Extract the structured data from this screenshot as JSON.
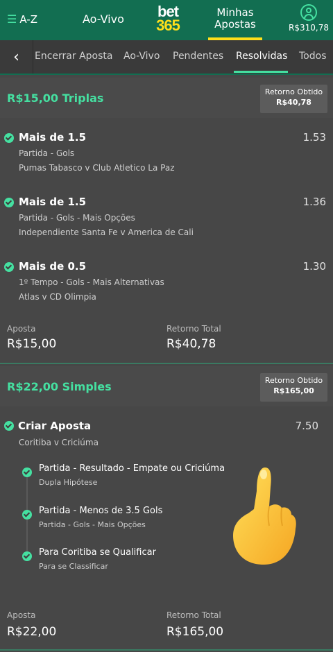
{
  "topbar": {
    "az_label": "A-Z",
    "aovivo_label": "Ao-Vivo",
    "logo_top": "bet",
    "logo_bottom": "365",
    "minhas_apostas": "Minhas Apostas",
    "balance": "R$310,78",
    "colors": {
      "brand_green": "#126e51",
      "accent_green": "#45e0a1",
      "brand_yellow": "#ffdf1b"
    }
  },
  "tabs": {
    "items": [
      "Encerrar Aposta",
      "Ao-Vivo",
      "Pendentes",
      "Resolvidas",
      "Todos"
    ],
    "active": "Resolvidas"
  },
  "bet1": {
    "title": "R$15,00 Triplas",
    "return_label": "Retorno Obtido",
    "return_value": "R$40,78",
    "selections": [
      {
        "name": "Mais de 1.5",
        "odd": "1.53",
        "market": "Partida - Gols",
        "event": "Pumas Tabasco v Club Atletico La Paz"
      },
      {
        "name": "Mais de 1.5",
        "odd": "1.36",
        "market": "Partida - Gols - Mais Opções",
        "event": "Independiente Santa Fe v America de Cali"
      },
      {
        "name": "Mais de 0.5",
        "odd": "1.30",
        "market": "1º Tempo - Gols - Mais Alternativas",
        "event": "Atlas v CD Olimpia"
      }
    ],
    "stake_label": "Aposta",
    "stake_value": "R$15,00",
    "total_label": "Retorno Total",
    "total_value": "R$40,78"
  },
  "bet2": {
    "title": "R$22,00 Simples",
    "return_label": "Retorno Obtido",
    "return_value": "R$165,00",
    "selection": {
      "name": "Criar Aposta",
      "odd": "7.50",
      "event": "Coritiba v Criciúma"
    },
    "legs": [
      {
        "title": "Partida - Resultado - Empate ou Criciúma",
        "sub": "Dupla Hipótese"
      },
      {
        "title": "Partida - Menos de 3.5 Gols",
        "sub": "Partida - Gols - Mais Opções"
      },
      {
        "title": "Para Coritiba se Qualificar",
        "sub": "Para se Classificar"
      }
    ],
    "stake_label": "Aposta",
    "stake_value": "R$22,00",
    "total_label": "Retorno Total",
    "total_value": "R$165,00"
  },
  "overlay": {
    "icon": "pointing-hand-emoji-icon"
  }
}
